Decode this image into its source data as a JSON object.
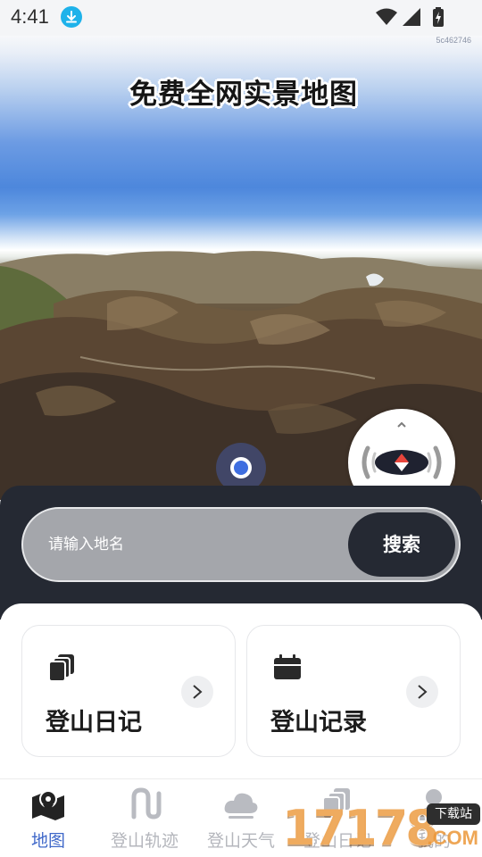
{
  "status_bar": {
    "time": "4:41"
  },
  "map": {
    "map_code": "5c462746",
    "banner": "免费全网实景地图"
  },
  "search": {
    "placeholder": "请输入地名",
    "button_label": "搜索"
  },
  "cards": [
    {
      "title": "登山日记",
      "icon": "notes-stack-icon"
    },
    {
      "title": "登山记录",
      "icon": "calendar-icon"
    }
  ],
  "bottom_nav": {
    "items": [
      {
        "label": "地图",
        "icon": "map-icon",
        "active": true
      },
      {
        "label": "登山轨迹",
        "icon": "track-icon",
        "active": false
      },
      {
        "label": "登山天气",
        "icon": "cloud-icon",
        "active": false
      },
      {
        "label": "登山日记",
        "icon": "notes-stack-icon",
        "active": false
      },
      {
        "label": "我的",
        "icon": "person-icon",
        "active": false
      }
    ]
  },
  "watermark": {
    "digits": "17178",
    "tag": "下载站",
    "suffix": ".COM"
  },
  "colors": {
    "accent": "#3f68c9",
    "panel_dark": "#252933",
    "search_bar": "#a4a6ab",
    "compass_red": "#e8453c",
    "badge": "#1eb2ea"
  }
}
